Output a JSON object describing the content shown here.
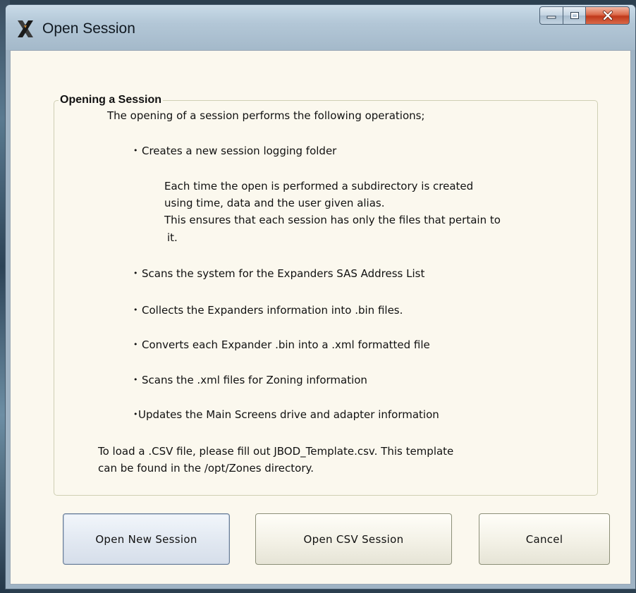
{
  "window": {
    "title": "Open Session",
    "app_icon": "x-logo-icon",
    "controls": [
      "minimize-icon",
      "maximize-icon",
      "close-icon"
    ]
  },
  "group": {
    "legend": "Opening a Session",
    "intro": "The opening of a session performs the following operations;",
    "bullets": [
      {
        "marker": "•",
        "text": "Creates a new session logging folder"
      },
      {
        "marker": "•",
        "text": "Scans the system for the Expanders SAS Address List"
      },
      {
        "marker": "•",
        "text": "Collects the Expanders information into .bin files."
      },
      {
        "marker": "•",
        "text": "Converts each Expander .bin into a .xml formatted file"
      },
      {
        "marker": "•",
        "text": "Scans the .xml files for Zoning information"
      },
      {
        "marker": "•",
        "text": "Updates the Main Screens drive and adapter information"
      }
    ],
    "detail_lines": [
      "Each time the open is performed a subdirectory is created",
      "using time, data and the user given alias.",
      "This ensures that each session has only the files that pertain to",
      "it."
    ],
    "csv_note_lines": [
      "To load a .CSV file, please fill out JBOD_Template.csv. This template",
      "can be found in the /opt/Zones directory."
    ]
  },
  "buttons": {
    "open_new": "Open New Session",
    "open_csv": "Open CSV Session",
    "cancel": "Cancel"
  }
}
